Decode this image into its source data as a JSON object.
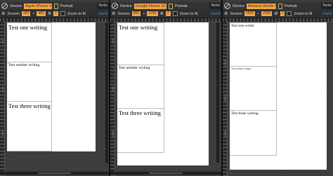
{
  "panes": [
    {
      "device_label": "Device",
      "device_value": "Apple iPhone 4",
      "orientation_label": "Portrait",
      "network_label": "Netw",
      "screen_label": "Screen",
      "width": "320",
      "height": "480",
      "zoom_value": "2",
      "zoom_label": "Zoom to fit",
      "rulers": {
        "h": [
          "|100",
          "300",
          "400",
          "500",
          "600"
        ],
        "v": [
          "100",
          "500",
          "1000",
          "1500"
        ]
      },
      "texts": [
        "Test one writing",
        "Test another writing",
        "Test three writing"
      ]
    },
    {
      "device_label": "Device",
      "device_value": "Google Nexus 10",
      "orientation_label": "Portrait",
      "network_label": "Netw",
      "screen_label": "Screen",
      "width": "800",
      "height": "1280",
      "zoom_value": "2",
      "zoom_label": "Zoom to fit",
      "rulers": {
        "h": [
          "300",
          "400",
          "500"
        ],
        "v": [
          "100",
          "500",
          "1000",
          "1500"
        ]
      },
      "texts": [
        "Test one writing",
        "Test another writing",
        "Test three writing"
      ]
    },
    {
      "device_label": "Device",
      "device_value": "Amazon Kindle Fire H",
      "orientation_label": "Portrait",
      "network_label": "Netw",
      "screen_label": "Screen",
      "width": "1600",
      "height": "2560",
      "zoom_value": "2",
      "zoom_label": "Zoom to fit",
      "rulers": {
        "h": [
          "300",
          "400",
          "500"
        ],
        "v": [
          "1000",
          "1500",
          "2000",
          "2500"
        ]
      },
      "texts": [
        "Test one writer",
        "Test another writing",
        "Test three writing"
      ]
    }
  ]
}
